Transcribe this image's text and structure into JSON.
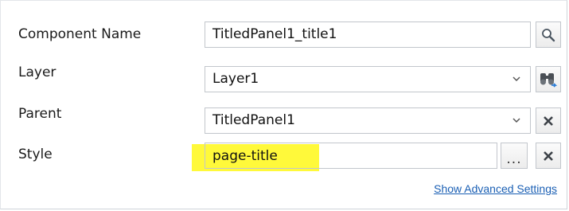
{
  "properties": {
    "rows": [
      {
        "label": "Component Name",
        "value": "TitledPanel1_title1",
        "button_icon": "search-icon"
      },
      {
        "label": "Layer",
        "value": "Layer1",
        "button_icon": "binoculars-icon"
      },
      {
        "label": "Parent",
        "value": "TitledPanel1",
        "button_icon": "clear-icon"
      },
      {
        "label": "Style",
        "value": "page-title",
        "ellipsis": "...",
        "button_icon": "clear-icon"
      }
    ],
    "advanced_link": "Show Advanced Settings"
  },
  "colors": {
    "highlight": "#fff93a",
    "link": "#1a5fb4"
  }
}
